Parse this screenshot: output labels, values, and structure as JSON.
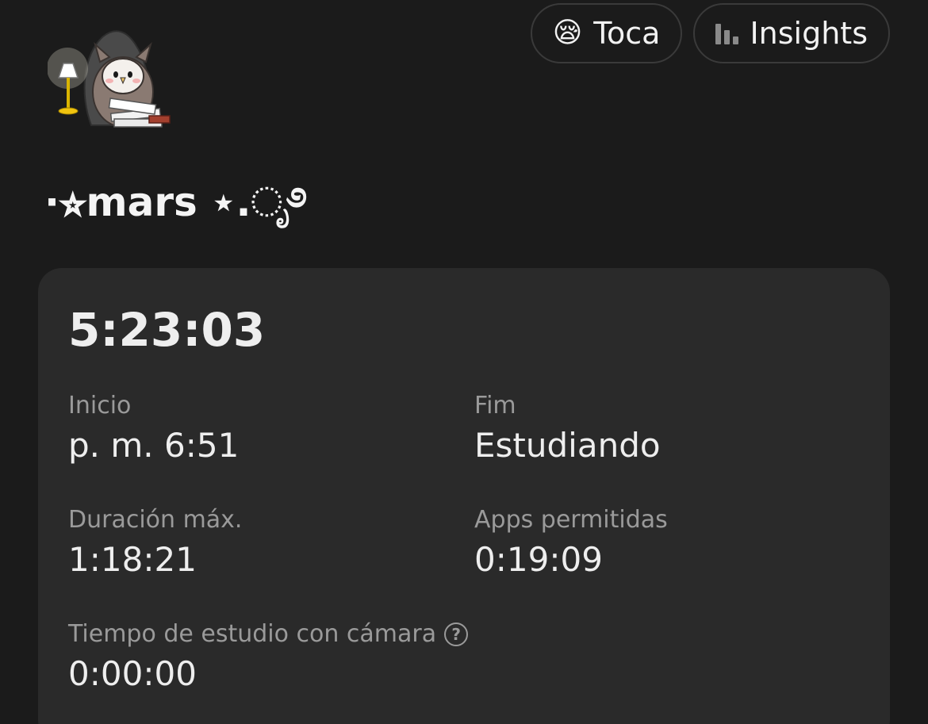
{
  "header": {
    "buttons": [
      {
        "label": "Toca",
        "icon": "sleepy-face-emoji",
        "emoji": "😪"
      },
      {
        "label": "Insights",
        "icon": "bar-chart-icon"
      }
    ]
  },
  "profile": {
    "username": "·⭐︎mars ⋆.ೃ࿔",
    "avatar": "owl-studying-with-lamp-illustration"
  },
  "session": {
    "timer": "5:23:03",
    "fields": [
      {
        "label": "Inicio",
        "value": "p. m. 6:51"
      },
      {
        "label": "Fim",
        "value": "Estudiando"
      },
      {
        "label": "Duración máx.",
        "value": "1:18:21"
      },
      {
        "label": "Apps permitidas",
        "value": "0:19:09"
      },
      {
        "label": "Tiempo de estudio con cámara",
        "value": "0:00:00",
        "icon": "help-icon",
        "icon_glyph": "?"
      }
    ]
  },
  "colors": {
    "background": "#1b1b1b",
    "card": "#2a2a2a",
    "label": "#9a9a9a",
    "value": "#eeeeee"
  }
}
